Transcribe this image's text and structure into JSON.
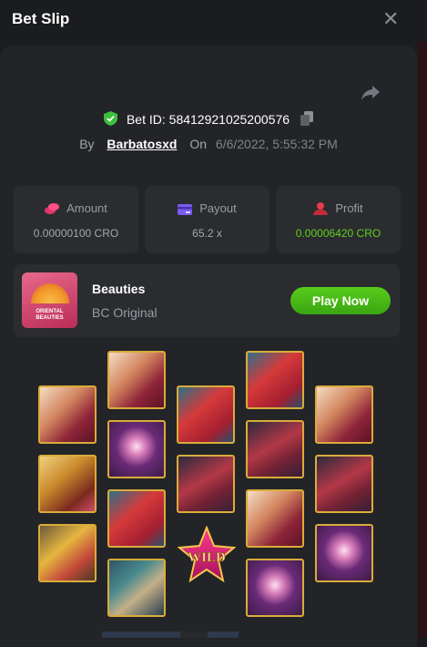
{
  "header": {
    "title": "Bet Slip",
    "close_label": "✕"
  },
  "bet": {
    "id_label": "Bet ID: 58412921025200576",
    "by_label": "By",
    "user": "Barbatosxd",
    "on_label": "On",
    "date": "6/6/2022, 5:55:32 PM"
  },
  "stats": {
    "amount": {
      "label": "Amount",
      "value": "0.00000100 CRO"
    },
    "payout": {
      "label": "Payout",
      "value": "65.2 x"
    },
    "profit": {
      "label": "Profit",
      "value": "0.00006420 CRO"
    }
  },
  "game": {
    "name": "Beauties",
    "subtitle": "BC Original",
    "play_label": "Play Now",
    "thumb_caption": "ORIENTAL BEAUTIES"
  },
  "slot": {
    "wild_label": "WILD",
    "reels": [
      [
        "fan",
        "comb",
        "hairpin"
      ],
      [
        "fan",
        "lotus",
        "book",
        "fish"
      ],
      [
        "book",
        "lute",
        "wild"
      ],
      [
        "book",
        "lute",
        "fan",
        "lotus"
      ],
      [
        "fan",
        "lute",
        "lotus"
      ]
    ]
  },
  "colors": {
    "accent_green": "#5fd11c",
    "play_green": "#3aa511",
    "gold_border": "#d9ac3a",
    "panel": "#232427",
    "card": "#2b2c30"
  },
  "icons": [
    "share-icon",
    "shield-check-icon",
    "copy-icon",
    "close-icon",
    "coins-icon",
    "card-icon",
    "profit-icon"
  ]
}
